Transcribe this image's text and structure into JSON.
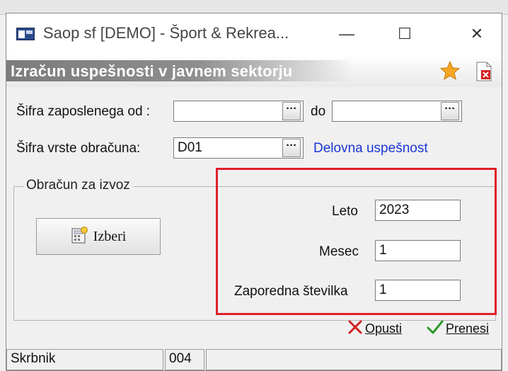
{
  "window": {
    "title": "Saop sf [DEMO] - Šport & Rekrea...",
    "minimize_glyph": "—",
    "maximize_glyph": "☐",
    "close_glyph": "✕"
  },
  "banner": {
    "title": "Izračun uspešnosti v javnem sektorju"
  },
  "form": {
    "sifra_zaposlenega_od_label": "Šifra zaposlenega od :",
    "sifra_zaposlenega_od_value": "",
    "do_label": "do",
    "do_value": "",
    "sifra_vrste_obracuna_label": "Šifra vrste obračuna:",
    "sifra_vrste_obracuna_value": "D01",
    "sifra_vrste_obracuna_description": "Delovna uspešnost",
    "browse_glyph": "···"
  },
  "obracun": {
    "group_label": "Obračun za izvoz",
    "izberi_label": "Izberi",
    "leto_label": "Leto",
    "leto_value": "2023",
    "mesec_label": "Mesec",
    "mesec_value": "1",
    "zaporedna_label": "Zaporedna številka",
    "zaporedna_value": "1"
  },
  "actions": {
    "opusti_label": "Opusti",
    "prenesi_label": "Prenesi"
  },
  "statusbar": {
    "user": "Skrbnik",
    "code": "004",
    "extra": ""
  },
  "colors": {
    "link": "#1a36d6",
    "highlight_box": "#e0202a",
    "star": "#f5a623",
    "cancel_x": "#d42020",
    "accept_check": "#2a9a2a"
  }
}
